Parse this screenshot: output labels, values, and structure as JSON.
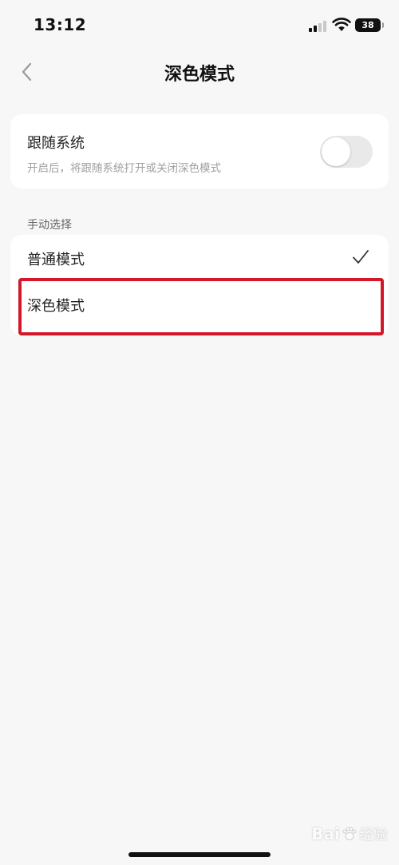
{
  "status_bar": {
    "time": "13:12",
    "battery": "38"
  },
  "nav": {
    "title": "深色模式",
    "back_icon": "chevron-left-icon"
  },
  "follow_system": {
    "title": "跟随系统",
    "description": "开启后，将跟随系统打开或关闭深色模式",
    "enabled": false
  },
  "manual_section": {
    "label": "手动选择",
    "options": [
      {
        "label": "普通模式",
        "selected": true
      },
      {
        "label": "深色模式",
        "selected": false
      }
    ]
  },
  "annotation": {
    "highlight_color": "#d4172a",
    "highlighted_option": "深色模式"
  },
  "watermark": {
    "logo": "Bai",
    "text": "经验"
  },
  "colors": {
    "background": "#f7f7f7",
    "card": "#ffffff",
    "toggle_off": "#e9e9ea"
  }
}
